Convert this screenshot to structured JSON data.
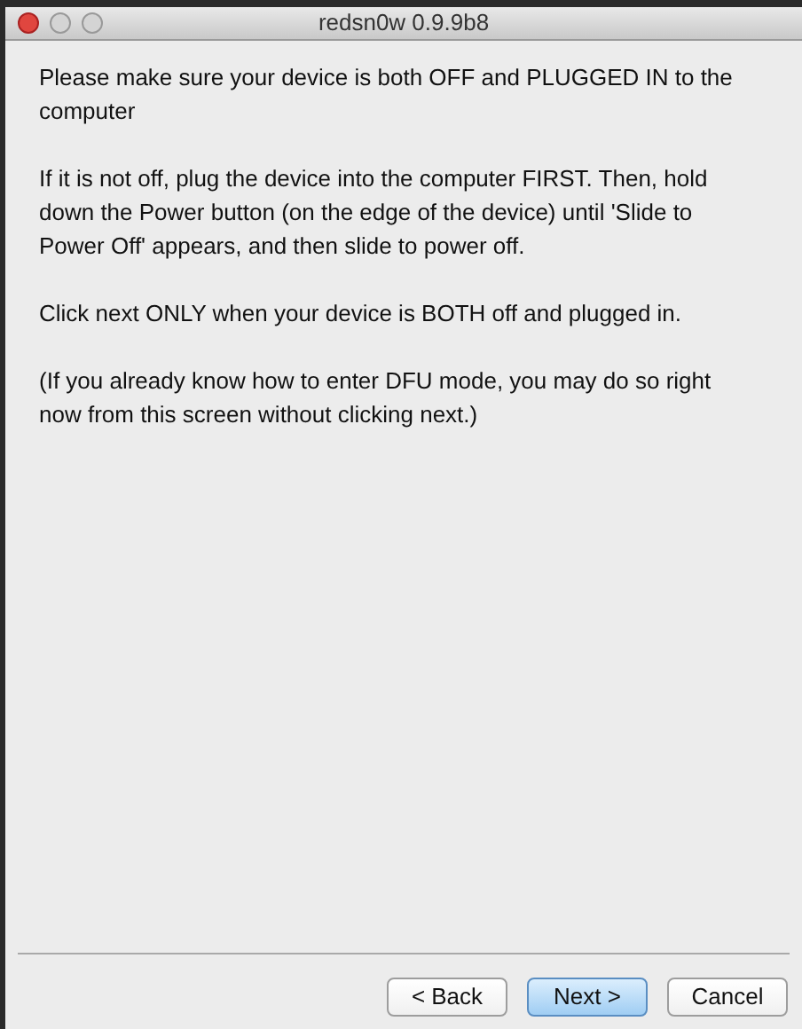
{
  "window": {
    "title": "redsn0w 0.9.9b8"
  },
  "paragraphs": [
    "Please make sure your device is both OFF and PLUGGED IN to the computer",
    "If it is not off, plug the device into the computer FIRST. Then, hold down the Power button (on the edge of the device) until 'Slide to Power Off' appears, and then slide to power off.",
    "Click next ONLY when your device is BOTH off and plugged in.",
    "(If you already know how to enter DFU mode, you may do so right now from this screen without clicking next.)"
  ],
  "buttons": [
    {
      "label": "< Back",
      "default": false
    },
    {
      "label": "Next >",
      "default": true
    },
    {
      "label": "Cancel",
      "default": false
    }
  ]
}
